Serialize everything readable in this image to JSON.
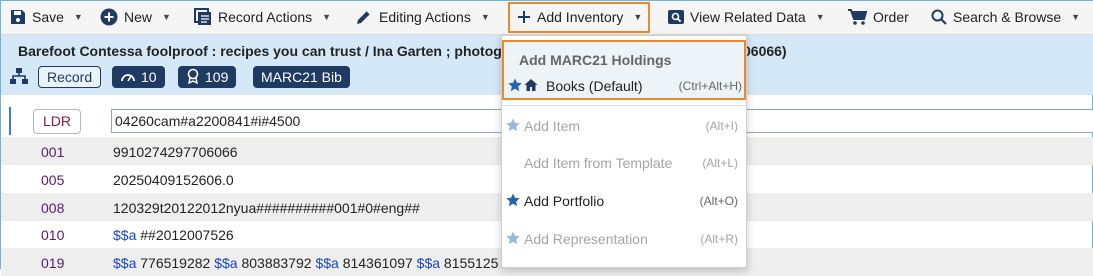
{
  "toolbar": {
    "save": "Save",
    "new": "New",
    "record_actions": "Record Actions",
    "editing_actions": "Editing Actions",
    "add_inventory": "Add Inventory",
    "view_related": "View Related Data",
    "order": "Order",
    "search_browse": "Search & Browse"
  },
  "record": {
    "title": "Barefoot Contessa foolproof : recipes you can trust / Ina Garten ; photograp",
    "title_tail": "06066)",
    "record_label": "Record",
    "speed_count": "10",
    "award_count": "109",
    "format": "MARC21 Bib"
  },
  "fields": [
    {
      "tag": "LDR",
      "value": "04260cam#a2200841#i#4500"
    },
    {
      "tag": "001",
      "value": "9910274297706066"
    },
    {
      "tag": "005",
      "value": "20250409152606.0"
    },
    {
      "tag": "008",
      "value": "120329t20122012nyua##########001#0#eng##"
    },
    {
      "tag": "010",
      "sf": "$$a",
      "value": "##2012007526"
    },
    {
      "tag": "019",
      "parts": [
        {
          "sf": "$$a",
          "text": "776519282"
        },
        {
          "sf": "$$a",
          "text": "803883792"
        },
        {
          "sf": "$$a",
          "text": "814361097"
        },
        {
          "sf": "$$a",
          "text": "8155125"
        }
      ]
    }
  ],
  "dropdown": {
    "section_title": "Add MARC21 Holdings",
    "books": {
      "label": "Books (Default)",
      "shortcut": "(Ctrl+Alt+H)"
    },
    "add_item": {
      "label": "Add Item",
      "shortcut": "(Alt+I)"
    },
    "add_item_template": {
      "label": "Add Item from Template",
      "shortcut": "(Alt+L)"
    },
    "add_portfolio": {
      "label": "Add Portfolio",
      "shortcut": "(Alt+O)"
    },
    "add_representation": {
      "label": "Add Representation",
      "shortcut": "(Alt+R)"
    }
  },
  "colors": {
    "accent": "#e8892a",
    "header_bg": "#d5e8f7",
    "navy": "#1f3a63",
    "star": "#2266b0"
  }
}
